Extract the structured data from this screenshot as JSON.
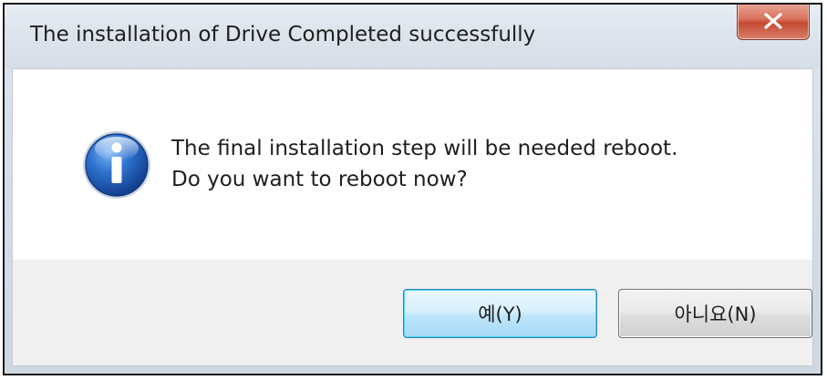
{
  "dialog": {
    "title": "The installation of Drive Completed successfully",
    "close_icon": "close-icon",
    "icon": "information-icon",
    "message_line1": "The final installation step will be needed reboot.",
    "message_line2": "Do you want to reboot now?",
    "buttons": {
      "yes_label": "예(Y)",
      "no_label": "아니요(N)"
    }
  },
  "colors": {
    "close_button": "#c44a31",
    "info_icon": "#1f5fbf",
    "default_button_border": "#3c7fb1"
  }
}
